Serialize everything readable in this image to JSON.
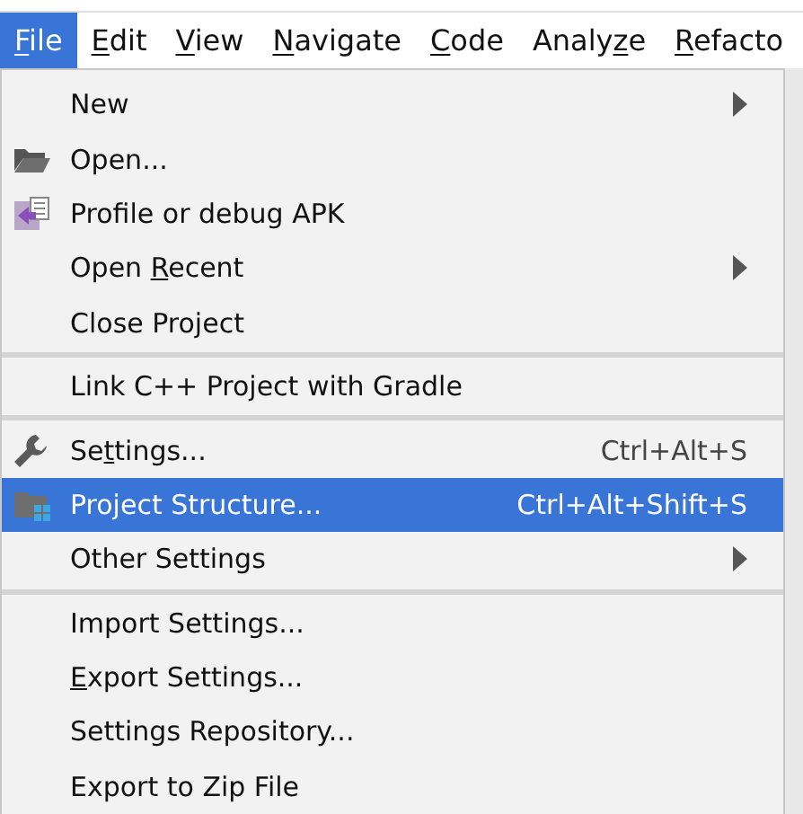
{
  "menu_bar": [
    {
      "key": "F",
      "post": "ile",
      "selected": true
    },
    {
      "key": "E",
      "post": "dit",
      "selected": false
    },
    {
      "key": "V",
      "post": "iew",
      "selected": false
    },
    {
      "key": "N",
      "post": "avigate",
      "selected": false
    },
    {
      "key": "C",
      "post": "ode",
      "selected": false
    },
    {
      "pre": "Analy",
      "key": "z",
      "post": "e",
      "selected": false
    },
    {
      "key": "R",
      "post": "efacto",
      "selected": false
    }
  ],
  "file_menu": [
    {
      "kind": "item",
      "pre": "New",
      "submenu": true,
      "selected": false
    },
    {
      "kind": "folder_item",
      "pre": "Open...",
      "submenu": false,
      "selected": false
    },
    {
      "kind": "apk_item",
      "pre": "Profile or debug APK",
      "submenu": false,
      "selected": false
    },
    {
      "kind": "item",
      "pre": "Open ",
      "key": "R",
      "post": "ecent",
      "submenu": true,
      "selected": false
    },
    {
      "kind": "item",
      "pre": "Close Project",
      "submenu": false,
      "selected": false
    },
    {
      "kind": "separator"
    },
    {
      "kind": "item",
      "pre": "Link C++ Project with Gradle",
      "submenu": false,
      "selected": false
    },
    {
      "kind": "separator"
    },
    {
      "kind": "wrench_item",
      "pre": "Se",
      "key": "t",
      "post": "tings...",
      "shortcut": "Ctrl+Alt+S",
      "submenu": false,
      "selected": false
    },
    {
      "kind": "structure_item",
      "pre": "Project Structure...",
      "shortcut": "Ctrl+Alt+Shift+S",
      "submenu": false,
      "selected": true
    },
    {
      "kind": "item",
      "pre": "Other Settings",
      "submenu": true,
      "selected": false
    },
    {
      "kind": "separator"
    },
    {
      "kind": "item",
      "pre": "Import Settings...",
      "submenu": false,
      "selected": false
    },
    {
      "kind": "item",
      "key": "E",
      "post": "xport Settings...",
      "submenu": false,
      "selected": false
    },
    {
      "kind": "item",
      "pre": "Settings Repository...",
      "submenu": false,
      "selected": false
    },
    {
      "kind": "item",
      "pre": "Export to Zip File",
      "submenu": false,
      "selected": false
    }
  ]
}
